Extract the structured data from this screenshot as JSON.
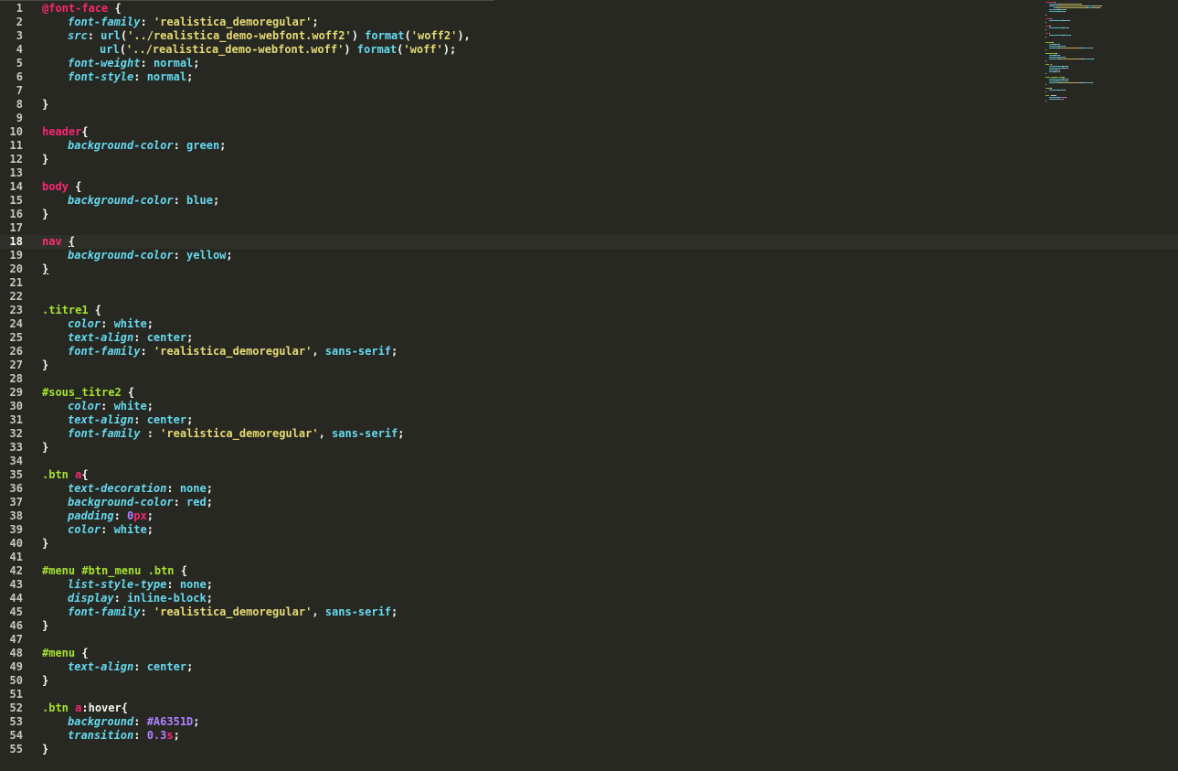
{
  "editor": {
    "language": "CSS",
    "active_line": 18,
    "colors": {
      "background": "#272822",
      "selector_tag": "#F92672",
      "selector_class": "#A6E22E",
      "property": "#66D9EF",
      "string": "#E6DB74",
      "number": "#AE81FF"
    },
    "lines": [
      [
        [
          "at",
          "@font-face"
        ],
        [
          "p",
          " {"
        ]
      ],
      [
        [
          "ind",
          ""
        ],
        [
          "prop",
          "font-family"
        ],
        [
          "p",
          ": "
        ],
        [
          "str",
          "'realistica_demoregular'"
        ],
        [
          "p",
          ";"
        ]
      ],
      [
        [
          "ind",
          ""
        ],
        [
          "prop",
          "src"
        ],
        [
          "p",
          ": "
        ],
        [
          "fn",
          "url"
        ],
        [
          "p",
          "("
        ],
        [
          "str",
          "'../realistica_demo-webfont.woff2'"
        ],
        [
          "p",
          ") "
        ],
        [
          "fn",
          "format"
        ],
        [
          "p",
          "("
        ],
        [
          "str",
          "'woff2'"
        ],
        [
          "p",
          "),"
        ]
      ],
      [
        [
          "ind2",
          ""
        ],
        [
          "fn",
          "url"
        ],
        [
          "p",
          "("
        ],
        [
          "str",
          "'../realistica_demo-webfont.woff'"
        ],
        [
          "p",
          ") "
        ],
        [
          "fn",
          "format"
        ],
        [
          "p",
          "("
        ],
        [
          "str",
          "'woff'"
        ],
        [
          "p",
          ");"
        ]
      ],
      [
        [
          "ind",
          ""
        ],
        [
          "prop",
          "font-weight"
        ],
        [
          "p",
          ": "
        ],
        [
          "val",
          "normal"
        ],
        [
          "p",
          ";"
        ]
      ],
      [
        [
          "ind",
          ""
        ],
        [
          "prop",
          "font-style"
        ],
        [
          "p",
          ": "
        ],
        [
          "val",
          "normal"
        ],
        [
          "p",
          ";"
        ]
      ],
      [],
      [
        [
          "p",
          "}"
        ]
      ],
      [],
      [
        [
          "tag",
          "header"
        ],
        [
          "p",
          "{"
        ]
      ],
      [
        [
          "ind",
          ""
        ],
        [
          "prop",
          "background-color"
        ],
        [
          "p",
          ": "
        ],
        [
          "val",
          "green"
        ],
        [
          "p",
          ";"
        ]
      ],
      [
        [
          "p",
          "}"
        ]
      ],
      [],
      [
        [
          "tag",
          "body"
        ],
        [
          "p",
          " {"
        ]
      ],
      [
        [
          "ind",
          ""
        ],
        [
          "prop",
          "background-color"
        ],
        [
          "p",
          ": "
        ],
        [
          "val",
          "blue"
        ],
        [
          "p",
          ";"
        ]
      ],
      [
        [
          "p",
          "}"
        ]
      ],
      [],
      [
        [
          "tag",
          "nav"
        ],
        [
          "p",
          " "
        ],
        [
          "pu",
          "{"
        ]
      ],
      [
        [
          "ind",
          ""
        ],
        [
          "prop",
          "background-color"
        ],
        [
          "p",
          ": "
        ],
        [
          "val",
          "yellow"
        ],
        [
          "p",
          ";"
        ]
      ],
      [
        [
          "pu",
          "}"
        ]
      ],
      [],
      [],
      [
        [
          "cls",
          ".titre1"
        ],
        [
          "p",
          " {"
        ]
      ],
      [
        [
          "ind",
          ""
        ],
        [
          "prop",
          "color"
        ],
        [
          "p",
          ": "
        ],
        [
          "val",
          "white"
        ],
        [
          "p",
          ";"
        ]
      ],
      [
        [
          "ind",
          ""
        ],
        [
          "prop",
          "text-align"
        ],
        [
          "p",
          ": "
        ],
        [
          "val",
          "center"
        ],
        [
          "p",
          ";"
        ]
      ],
      [
        [
          "ind",
          ""
        ],
        [
          "prop",
          "font-family"
        ],
        [
          "p",
          ": "
        ],
        [
          "str",
          "'realistica_demoregular'"
        ],
        [
          "p",
          ", "
        ],
        [
          "val",
          "sans-serif"
        ],
        [
          "p",
          ";"
        ]
      ],
      [
        [
          "p",
          "}"
        ]
      ],
      [],
      [
        [
          "cls",
          "#sous_titre2"
        ],
        [
          "p",
          " {"
        ]
      ],
      [
        [
          "ind",
          ""
        ],
        [
          "prop",
          "color"
        ],
        [
          "p",
          ": "
        ],
        [
          "val",
          "white"
        ],
        [
          "p",
          ";"
        ]
      ],
      [
        [
          "ind",
          ""
        ],
        [
          "prop",
          "text-align"
        ],
        [
          "p",
          ": "
        ],
        [
          "val",
          "center"
        ],
        [
          "p",
          ";"
        ]
      ],
      [
        [
          "ind",
          ""
        ],
        [
          "prop",
          "font-family"
        ],
        [
          "p",
          " : "
        ],
        [
          "str",
          "'realistica_demoregular'"
        ],
        [
          "p",
          ", "
        ],
        [
          "val",
          "sans-serif"
        ],
        [
          "p",
          ";"
        ]
      ],
      [
        [
          "p",
          "}"
        ]
      ],
      [],
      [
        [
          "cls",
          ".btn"
        ],
        [
          "p",
          " "
        ],
        [
          "tag",
          "a"
        ],
        [
          "p",
          "{"
        ]
      ],
      [
        [
          "ind",
          ""
        ],
        [
          "prop",
          "text-decoration"
        ],
        [
          "p",
          ": "
        ],
        [
          "val",
          "none"
        ],
        [
          "p",
          ";"
        ]
      ],
      [
        [
          "ind",
          ""
        ],
        [
          "prop",
          "background-color"
        ],
        [
          "p",
          ": "
        ],
        [
          "val",
          "red"
        ],
        [
          "p",
          ";"
        ]
      ],
      [
        [
          "ind",
          ""
        ],
        [
          "prop",
          "padding"
        ],
        [
          "p",
          ": "
        ],
        [
          "num",
          "0"
        ],
        [
          "unit",
          "px"
        ],
        [
          "p",
          ";"
        ]
      ],
      [
        [
          "ind",
          ""
        ],
        [
          "prop",
          "color"
        ],
        [
          "p",
          ": "
        ],
        [
          "val",
          "white"
        ],
        [
          "p",
          ";"
        ]
      ],
      [
        [
          "p",
          "}"
        ]
      ],
      [],
      [
        [
          "cls",
          "#menu"
        ],
        [
          "p",
          " "
        ],
        [
          "cls",
          "#btn_menu"
        ],
        [
          "p",
          " "
        ],
        [
          "cls",
          ".btn"
        ],
        [
          "p",
          " {"
        ]
      ],
      [
        [
          "ind",
          ""
        ],
        [
          "prop",
          "list-style-type"
        ],
        [
          "p",
          ": "
        ],
        [
          "val",
          "none"
        ],
        [
          "p",
          ";"
        ]
      ],
      [
        [
          "ind",
          ""
        ],
        [
          "prop",
          "display"
        ],
        [
          "p",
          ": "
        ],
        [
          "val",
          "inline-block"
        ],
        [
          "p",
          ";"
        ]
      ],
      [
        [
          "ind",
          ""
        ],
        [
          "prop",
          "font-family"
        ],
        [
          "p",
          ": "
        ],
        [
          "str",
          "'realistica_demoregular'"
        ],
        [
          "p",
          ", "
        ],
        [
          "val",
          "sans-serif"
        ],
        [
          "p",
          ";"
        ]
      ],
      [
        [
          "p",
          "}"
        ]
      ],
      [],
      [
        [
          "cls",
          "#menu"
        ],
        [
          "p",
          " {"
        ]
      ],
      [
        [
          "ind",
          ""
        ],
        [
          "prop",
          "text-align"
        ],
        [
          "p",
          ": "
        ],
        [
          "val",
          "center"
        ],
        [
          "p",
          ";"
        ]
      ],
      [
        [
          "p",
          "}"
        ]
      ],
      [],
      [
        [
          "cls",
          ".btn"
        ],
        [
          "p",
          " "
        ],
        [
          "tag",
          "a"
        ],
        [
          "p",
          ":hover{"
        ]
      ],
      [
        [
          "ind",
          ""
        ],
        [
          "prop",
          "background"
        ],
        [
          "p",
          ": "
        ],
        [
          "hex",
          "#A6351D"
        ],
        [
          "p",
          ";"
        ]
      ],
      [
        [
          "ind",
          ""
        ],
        [
          "prop",
          "transition"
        ],
        [
          "p",
          ": "
        ],
        [
          "num",
          "0.3"
        ],
        [
          "unit",
          "s"
        ],
        [
          "p",
          ";"
        ]
      ],
      [
        [
          "p",
          "}"
        ]
      ]
    ]
  }
}
